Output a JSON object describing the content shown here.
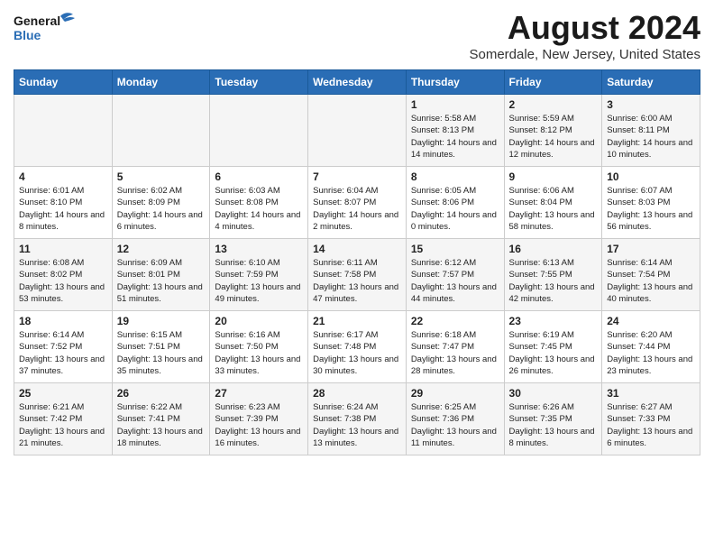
{
  "logo": {
    "general": "General",
    "blue": "Blue"
  },
  "title": "August 2024",
  "subtitle": "Somerdale, New Jersey, United States",
  "weekdays": [
    "Sunday",
    "Monday",
    "Tuesday",
    "Wednesday",
    "Thursday",
    "Friday",
    "Saturday"
  ],
  "weeks": [
    [
      {
        "day": "",
        "content": ""
      },
      {
        "day": "",
        "content": ""
      },
      {
        "day": "",
        "content": ""
      },
      {
        "day": "",
        "content": ""
      },
      {
        "day": "1",
        "content": "Sunrise: 5:58 AM\nSunset: 8:13 PM\nDaylight: 14 hours and 14 minutes."
      },
      {
        "day": "2",
        "content": "Sunrise: 5:59 AM\nSunset: 8:12 PM\nDaylight: 14 hours and 12 minutes."
      },
      {
        "day": "3",
        "content": "Sunrise: 6:00 AM\nSunset: 8:11 PM\nDaylight: 14 hours and 10 minutes."
      }
    ],
    [
      {
        "day": "4",
        "content": "Sunrise: 6:01 AM\nSunset: 8:10 PM\nDaylight: 14 hours and 8 minutes."
      },
      {
        "day": "5",
        "content": "Sunrise: 6:02 AM\nSunset: 8:09 PM\nDaylight: 14 hours and 6 minutes."
      },
      {
        "day": "6",
        "content": "Sunrise: 6:03 AM\nSunset: 8:08 PM\nDaylight: 14 hours and 4 minutes."
      },
      {
        "day": "7",
        "content": "Sunrise: 6:04 AM\nSunset: 8:07 PM\nDaylight: 14 hours and 2 minutes."
      },
      {
        "day": "8",
        "content": "Sunrise: 6:05 AM\nSunset: 8:06 PM\nDaylight: 14 hours and 0 minutes."
      },
      {
        "day": "9",
        "content": "Sunrise: 6:06 AM\nSunset: 8:04 PM\nDaylight: 13 hours and 58 minutes."
      },
      {
        "day": "10",
        "content": "Sunrise: 6:07 AM\nSunset: 8:03 PM\nDaylight: 13 hours and 56 minutes."
      }
    ],
    [
      {
        "day": "11",
        "content": "Sunrise: 6:08 AM\nSunset: 8:02 PM\nDaylight: 13 hours and 53 minutes."
      },
      {
        "day": "12",
        "content": "Sunrise: 6:09 AM\nSunset: 8:01 PM\nDaylight: 13 hours and 51 minutes."
      },
      {
        "day": "13",
        "content": "Sunrise: 6:10 AM\nSunset: 7:59 PM\nDaylight: 13 hours and 49 minutes."
      },
      {
        "day": "14",
        "content": "Sunrise: 6:11 AM\nSunset: 7:58 PM\nDaylight: 13 hours and 47 minutes."
      },
      {
        "day": "15",
        "content": "Sunrise: 6:12 AM\nSunset: 7:57 PM\nDaylight: 13 hours and 44 minutes."
      },
      {
        "day": "16",
        "content": "Sunrise: 6:13 AM\nSunset: 7:55 PM\nDaylight: 13 hours and 42 minutes."
      },
      {
        "day": "17",
        "content": "Sunrise: 6:14 AM\nSunset: 7:54 PM\nDaylight: 13 hours and 40 minutes."
      }
    ],
    [
      {
        "day": "18",
        "content": "Sunrise: 6:14 AM\nSunset: 7:52 PM\nDaylight: 13 hours and 37 minutes."
      },
      {
        "day": "19",
        "content": "Sunrise: 6:15 AM\nSunset: 7:51 PM\nDaylight: 13 hours and 35 minutes."
      },
      {
        "day": "20",
        "content": "Sunrise: 6:16 AM\nSunset: 7:50 PM\nDaylight: 13 hours and 33 minutes."
      },
      {
        "day": "21",
        "content": "Sunrise: 6:17 AM\nSunset: 7:48 PM\nDaylight: 13 hours and 30 minutes."
      },
      {
        "day": "22",
        "content": "Sunrise: 6:18 AM\nSunset: 7:47 PM\nDaylight: 13 hours and 28 minutes."
      },
      {
        "day": "23",
        "content": "Sunrise: 6:19 AM\nSunset: 7:45 PM\nDaylight: 13 hours and 26 minutes."
      },
      {
        "day": "24",
        "content": "Sunrise: 6:20 AM\nSunset: 7:44 PM\nDaylight: 13 hours and 23 minutes."
      }
    ],
    [
      {
        "day": "25",
        "content": "Sunrise: 6:21 AM\nSunset: 7:42 PM\nDaylight: 13 hours and 21 minutes."
      },
      {
        "day": "26",
        "content": "Sunrise: 6:22 AM\nSunset: 7:41 PM\nDaylight: 13 hours and 18 minutes."
      },
      {
        "day": "27",
        "content": "Sunrise: 6:23 AM\nSunset: 7:39 PM\nDaylight: 13 hours and 16 minutes."
      },
      {
        "day": "28",
        "content": "Sunrise: 6:24 AM\nSunset: 7:38 PM\nDaylight: 13 hours and 13 minutes."
      },
      {
        "day": "29",
        "content": "Sunrise: 6:25 AM\nSunset: 7:36 PM\nDaylight: 13 hours and 11 minutes."
      },
      {
        "day": "30",
        "content": "Sunrise: 6:26 AM\nSunset: 7:35 PM\nDaylight: 13 hours and 8 minutes."
      },
      {
        "day": "31",
        "content": "Sunrise: 6:27 AM\nSunset: 7:33 PM\nDaylight: 13 hours and 6 minutes."
      }
    ]
  ]
}
